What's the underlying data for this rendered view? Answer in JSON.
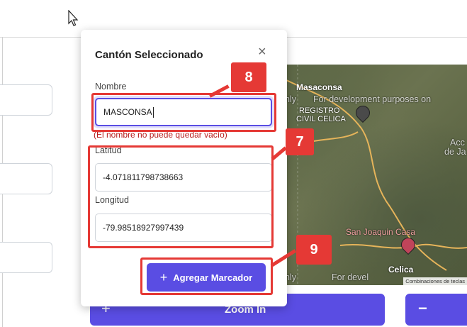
{
  "modal": {
    "title": "Cantón Seleccionado",
    "close_symbol": "×",
    "name_label": "Nombre",
    "name_value": "MASCONSA",
    "name_error": "(El nombre no puede quedar vacío)",
    "lat_label": "Latitud",
    "lat_value": "-4.071811798738663",
    "lon_label": "Longitud",
    "lon_value": "-79.98518927997439",
    "add_button_label": "Agregar Marcador",
    "add_button_icon": "+"
  },
  "map": {
    "place_1": "Masaconsa",
    "place_2": "REGISTRO",
    "place_3": "CIVIL CELICA",
    "place_4": "San Joaquin Casa",
    "place_5": "Celica",
    "dev_text": "For development purposes on",
    "dev_text_2": "For devel",
    "left_fragment_1": "nly",
    "left_fragment_2": "nly",
    "right_fragment_1": "Acc",
    "right_fragment_2": "de Ja",
    "attribution": "Combinaciones de teclas"
  },
  "zoom": {
    "zoom_in_symbol": "+",
    "zoom_in_label": "Zoom In",
    "zoom_out_symbol": "−"
  },
  "annotations": {
    "badge_8": "8",
    "badge_7": "7",
    "badge_9": "9",
    "color": "#e53935"
  },
  "colors": {
    "accent": "#5a4de3",
    "error": "#b71c1c"
  }
}
